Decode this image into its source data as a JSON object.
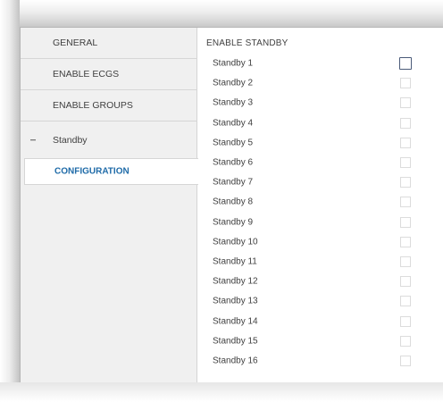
{
  "sidebar": {
    "items": [
      {
        "label": "GENERAL"
      },
      {
        "label": "ENABLE ECGS"
      },
      {
        "label": "ENABLE GROUPS"
      },
      {
        "label": "Standby"
      },
      {
        "label": "CONFIGURATION"
      }
    ]
  },
  "main": {
    "section_title": "ENABLE STANDBY",
    "rows": [
      {
        "label": "Standby 1",
        "checked": false
      },
      {
        "label": "Standby 2",
        "checked": false
      },
      {
        "label": "Standby 3",
        "checked": false
      },
      {
        "label": "Standby 4",
        "checked": false
      },
      {
        "label": "Standby 5",
        "checked": false
      },
      {
        "label": "Standby 6",
        "checked": false
      },
      {
        "label": "Standby 7",
        "checked": false
      },
      {
        "label": "Standby 8",
        "checked": false
      },
      {
        "label": "Standby 9",
        "checked": false
      },
      {
        "label": "Standby 10",
        "checked": false
      },
      {
        "label": "Standby 11",
        "checked": false
      },
      {
        "label": "Standby 12",
        "checked": false
      },
      {
        "label": "Standby 13",
        "checked": false
      },
      {
        "label": "Standby 14",
        "checked": false
      },
      {
        "label": "Standby 15",
        "checked": false
      },
      {
        "label": "Standby 16",
        "checked": false
      }
    ]
  },
  "colors": {
    "sidebar_bg": "#f0f0f0",
    "selected_text": "#1f6ba8",
    "text": "#404040",
    "checkbox_border": "#dcdcdc",
    "focus_border": "#4a5a78"
  }
}
